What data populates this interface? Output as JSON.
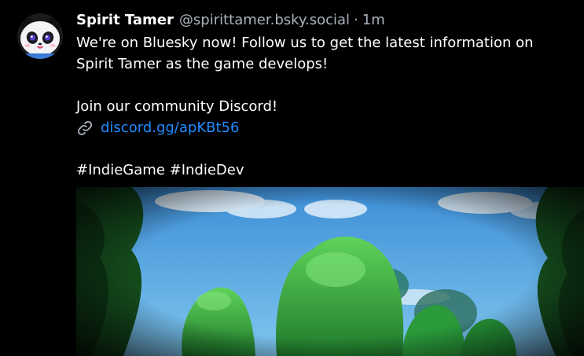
{
  "post": {
    "author": {
      "display_name": "Spirit Tamer",
      "handle": "@spirittamer.bsky.social",
      "avatar_icon": "panda-avatar-icon"
    },
    "separator": "·",
    "time_ago": "1m",
    "text": {
      "line1": "We're on Bluesky now! Follow us to get the latest information on",
      "line2": "Spirit Tamer as the game develops!",
      "community": "Join our community Discord!",
      "link_icon": "link-icon",
      "link_text": "discord.gg/apKBt56",
      "hashtags": [
        "#IndieGame",
        "#IndieDev"
      ]
    },
    "media": {
      "type": "image",
      "description_icon": "game-artwork-image"
    }
  },
  "colors": {
    "background": "#000000",
    "text": "#ffffff",
    "muted": "#aab2bd",
    "link": "#208bfe"
  }
}
